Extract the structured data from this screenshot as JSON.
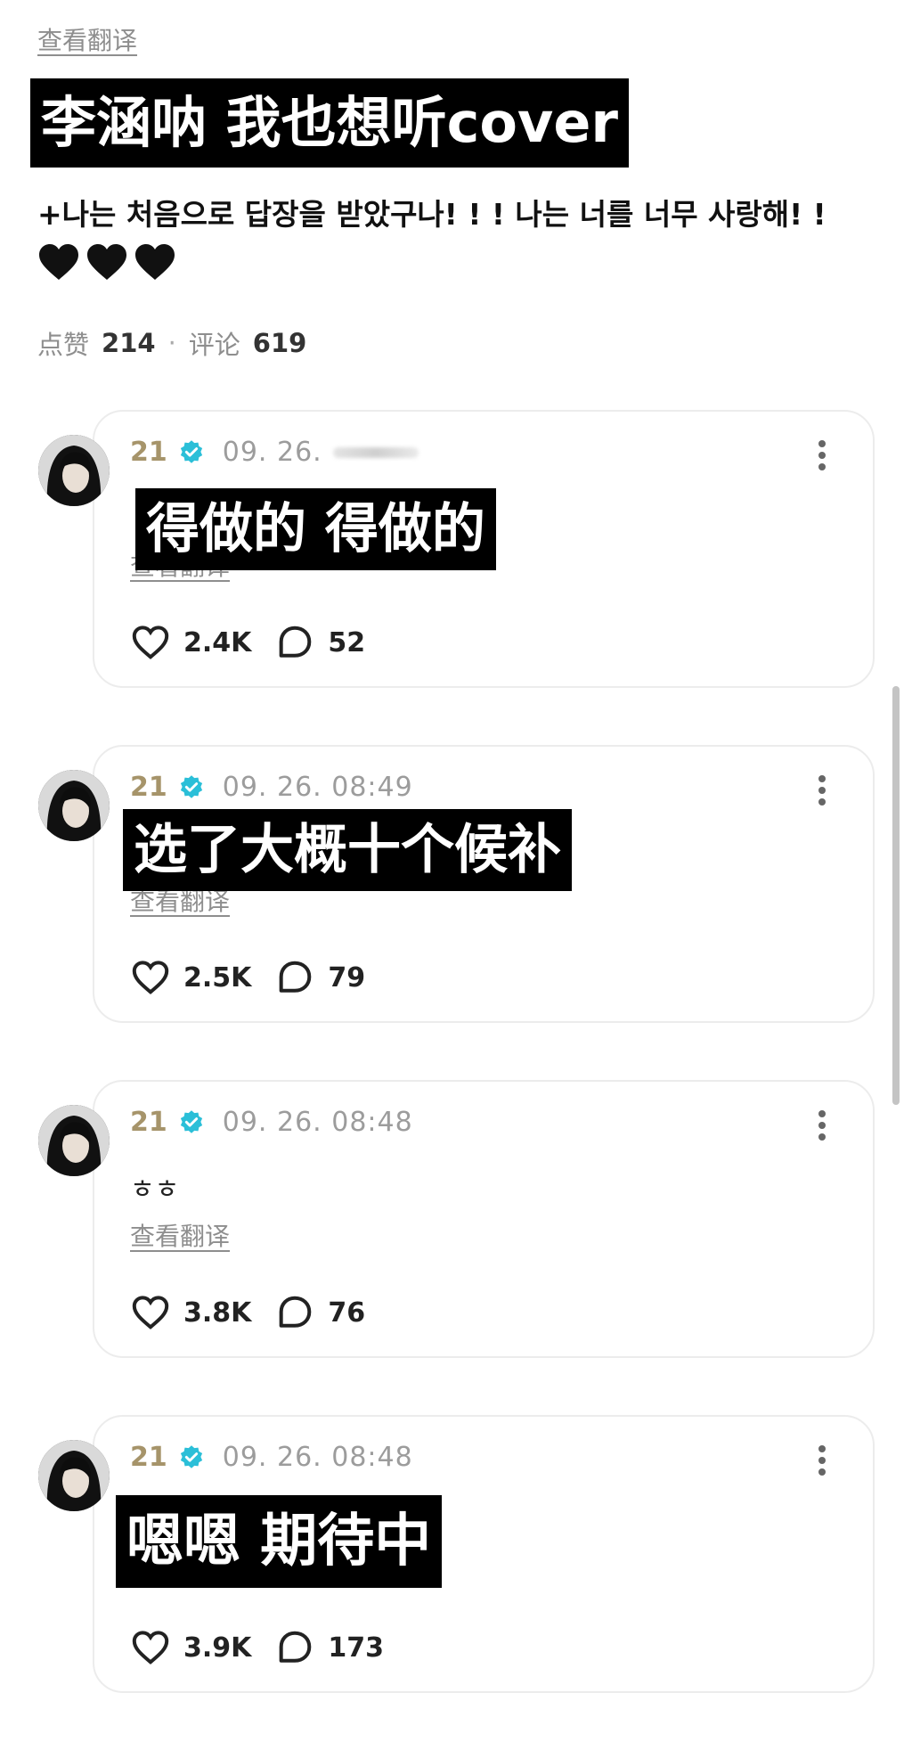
{
  "post": {
    "translate_label": "查看翻译",
    "caption": "李涵呐 我也想听cover",
    "body_text": "+나는 처음으로 답장을 받았구나! ! ! 나는 너를 너무 사랑해! !",
    "heart_icons": [
      "black-heart-icon",
      "black-heart-icon",
      "black-heart-icon"
    ],
    "likes_label": "点赞",
    "likes_count": "214",
    "separator": "·",
    "comments_label": "评论",
    "comments_count": "619"
  },
  "comments": [
    {
      "username": "21",
      "timestamp": "09. 26.",
      "caption": "得做的 得做的",
      "translate_label": "查看翻译",
      "likes": "2.4K",
      "replies": "52"
    },
    {
      "username": "21",
      "timestamp": "09. 26. 08:49",
      "caption": "选了大概十个候补",
      "translate_label": "查看翻译",
      "likes": "2.5K",
      "replies": "79"
    },
    {
      "username": "21",
      "timestamp": "09. 26. 08:48",
      "text": "ㅎㅎ",
      "translate_label": "查看翻译",
      "likes": "3.8K",
      "replies": "76"
    },
    {
      "username": "21",
      "timestamp": "09. 26. 08:48",
      "caption": "嗯嗯 期待中",
      "likes": "3.9K",
      "replies": "173"
    }
  ],
  "colors": {
    "username": "#a6946a",
    "verified_badge": "#2bbfd8",
    "caption_bg": "#000000",
    "muted_text": "#8e8e8e"
  }
}
